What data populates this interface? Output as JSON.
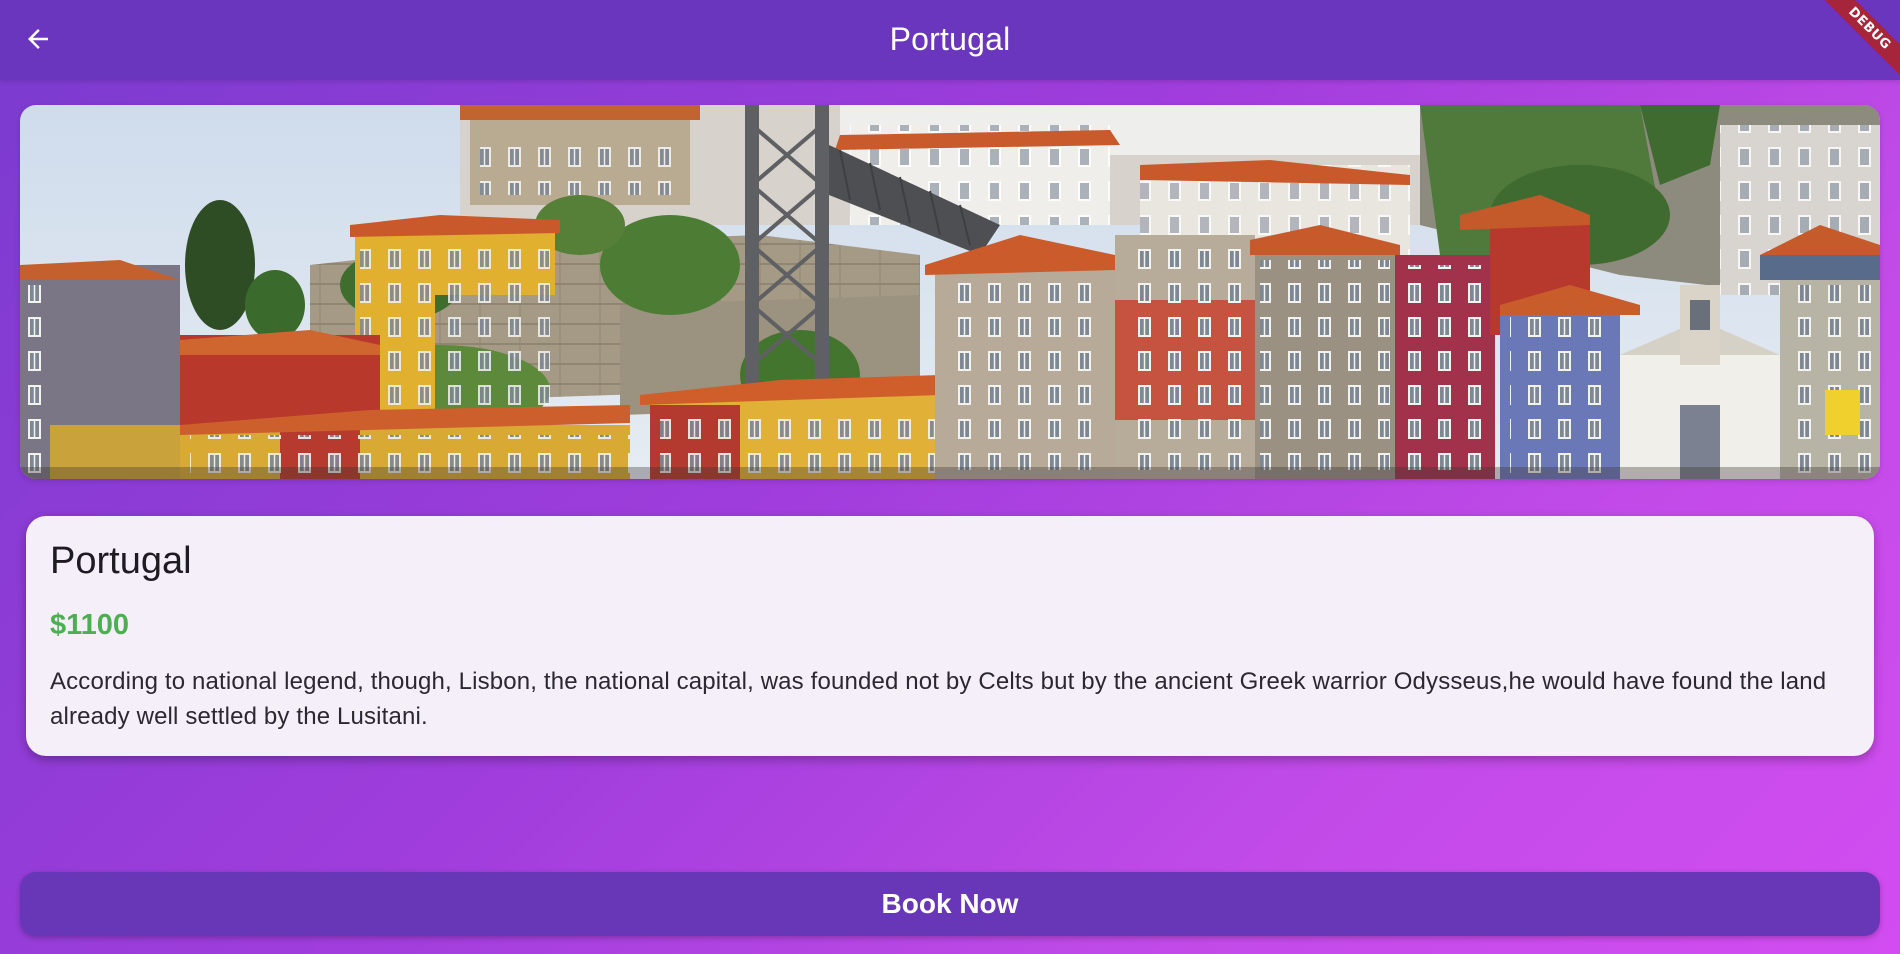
{
  "app_bar": {
    "title": "Portugal",
    "back_icon": "arrow-back-icon",
    "background": "#6a36bd"
  },
  "debug_banner": {
    "label": "DEBUG",
    "color": "#a6253a"
  },
  "hero_image": {
    "subject": "colorful riverside houses of Porto"
  },
  "card": {
    "title": "Portugal",
    "price": "$1100",
    "price_color": "#4caf50",
    "description": "According to national legend, though, Lisbon, the national capital, was founded not by Celts but by the ancient Greek warrior Odysseus,he would have found the land already well settled by the Lusitani."
  },
  "actions": {
    "book_label": "Book Now",
    "book_color": "#6837b8"
  }
}
